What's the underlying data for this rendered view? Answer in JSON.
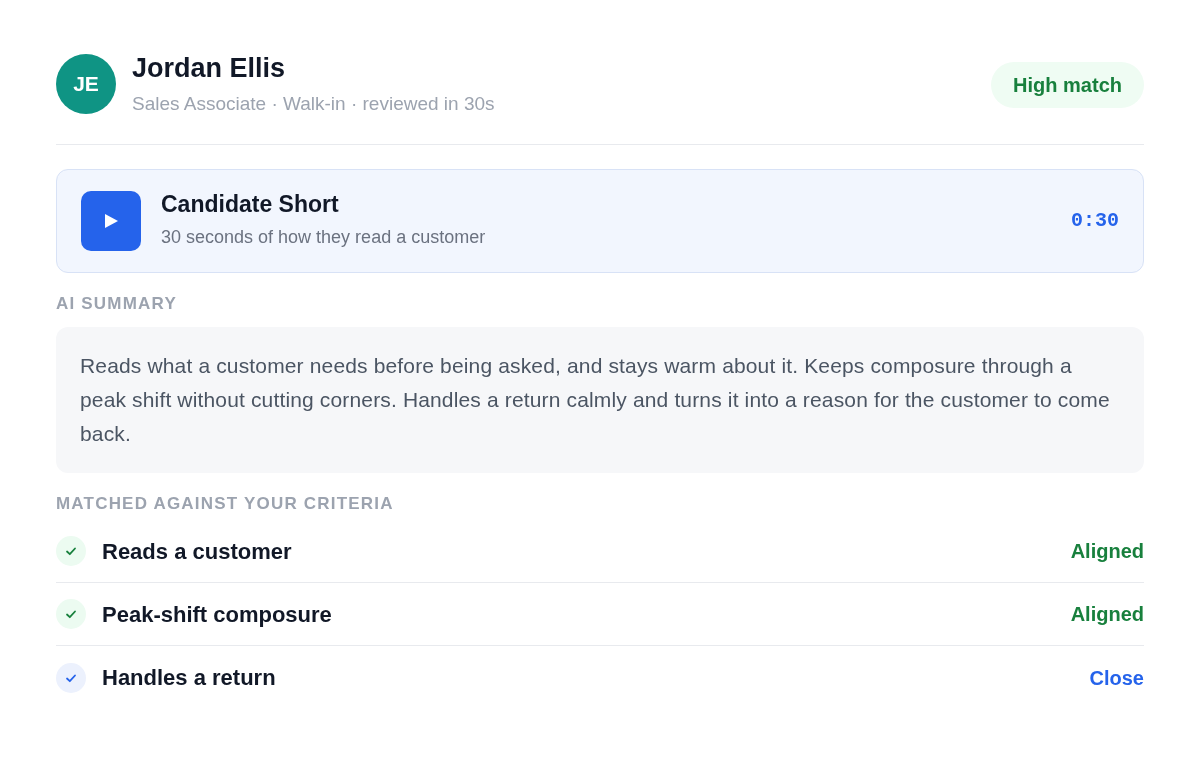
{
  "candidate": {
    "initials": "JE",
    "name": "Jordan Ellis",
    "subtitle": "Sales Associate · Walk-in · reviewed in 30s",
    "match_badge": "High match"
  },
  "video": {
    "title": "Candidate Short",
    "subtitle": "30 seconds of how they read a customer",
    "duration": "0:30"
  },
  "summary": {
    "heading": "AI SUMMARY",
    "text": "Reads what a customer needs before being asked, and stays warm about it. Keeps composure through a peak shift without cutting corners. Handles a return calmly and turns it into a reason for the customer to come back."
  },
  "criteria": {
    "heading": "MATCHED AGAINST YOUR CRITERIA",
    "items": [
      {
        "label": "Reads a customer",
        "status": "Aligned",
        "kind": "aligned"
      },
      {
        "label": "Peak-shift composure",
        "status": "Aligned",
        "kind": "aligned"
      },
      {
        "label": "Handles a return",
        "status": "Close",
        "kind": "close"
      }
    ]
  }
}
